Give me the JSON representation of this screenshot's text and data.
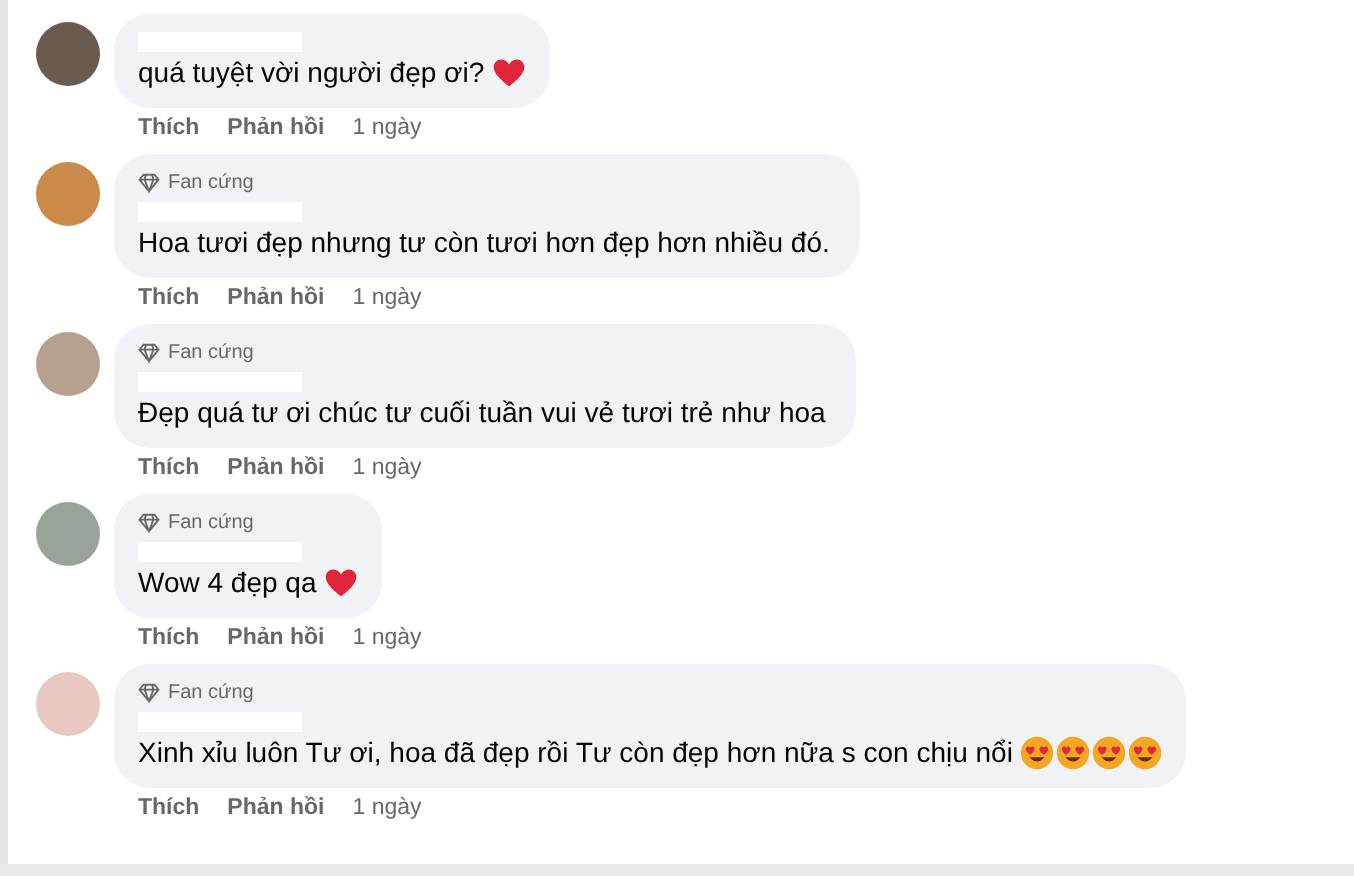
{
  "comments": [
    {
      "text": "quá tuyệt vời người đẹp ơi?",
      "emojis": [
        {
          "kind": "heart"
        }
      ],
      "actions": {
        "like": "Thích",
        "reply": "Phản hồi",
        "time": "1 ngày"
      }
    },
    {
      "badge": "Fan cứng",
      "text": "Hoa tươi đẹp nhưng tư còn tươi hơn đẹp hơn nhiều đó.",
      "actions": {
        "like": "Thích",
        "reply": "Phản hồi",
        "time": "1 ngày"
      }
    },
    {
      "badge": "Fan cứng",
      "text": "Đẹp quá tư ơi chúc tư cuối tuần vui vẻ tươi trẻ như hoa",
      "actions": {
        "like": "Thích",
        "reply": "Phản hồi",
        "time": "1 ngày"
      }
    },
    {
      "badge": "Fan cứng",
      "text": "Wow 4 đẹp qa",
      "emojis": [
        {
          "kind": "heart"
        }
      ],
      "actions": {
        "like": "Thích",
        "reply": "Phản hồi",
        "time": "1 ngày"
      }
    },
    {
      "badge": "Fan cứng",
      "text": "Xinh xỉu luôn Tư ơi, hoa đã đẹp rồi Tư còn đẹp hơn nữa s con chịu nổi",
      "emojis": [
        {
          "kind": "heart-eyes"
        },
        {
          "kind": "heart-eyes"
        },
        {
          "kind": "heart-eyes"
        },
        {
          "kind": "heart-eyes"
        }
      ],
      "actions": {
        "like": "Thích",
        "reply": "Phản hồi",
        "time": "1 ngày"
      }
    }
  ]
}
